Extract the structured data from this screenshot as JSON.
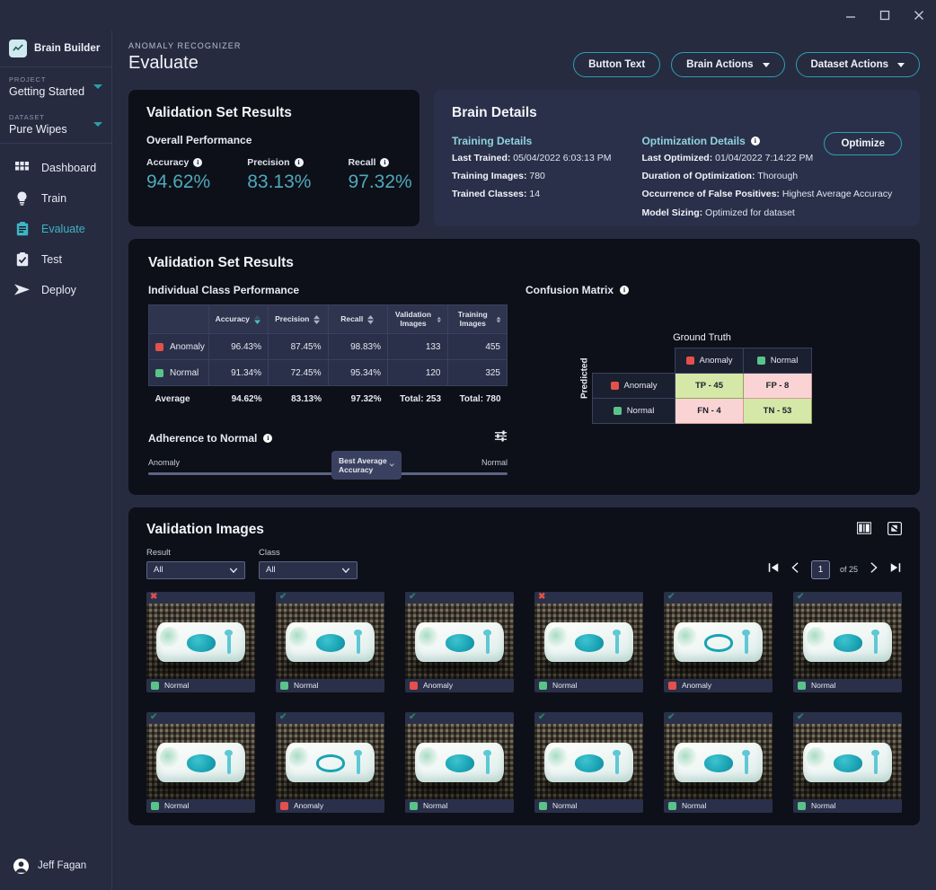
{
  "window": {
    "minimize": "minimize-icon",
    "maximize": "maximize-icon",
    "close": "close-icon"
  },
  "sidebar": {
    "brand": "Brain Builder",
    "project_label": "PROJECT",
    "project_value": "Getting Started",
    "dataset_label": "DATASET",
    "dataset_value": "Pure Wipes",
    "nav": [
      {
        "label": "Dashboard",
        "icon": "grid-icon",
        "active": false
      },
      {
        "label": "Train",
        "icon": "bulb-icon",
        "active": false
      },
      {
        "label": "Evaluate",
        "icon": "clipboard-icon",
        "active": true
      },
      {
        "label": "Test",
        "icon": "clipboard-check-icon",
        "active": false
      },
      {
        "label": "Deploy",
        "icon": "send-icon",
        "active": false
      }
    ],
    "user": "Jeff Fagan"
  },
  "header": {
    "eyebrow": "ANOMALY RECOGNIZER",
    "title": "Evaluate",
    "buttons": [
      {
        "label": "Button Text",
        "caret": false
      },
      {
        "label": "Brain Actions",
        "caret": true
      },
      {
        "label": "Dataset Actions",
        "caret": true
      }
    ]
  },
  "overall": {
    "title": "Validation Set Results",
    "subtitle": "Overall Performance",
    "metrics": [
      {
        "label": "Accuracy",
        "value": "94.62%"
      },
      {
        "label": "Precision",
        "value": "83.13%"
      },
      {
        "label": "Recall",
        "value": "97.32%"
      }
    ]
  },
  "brain_details": {
    "title": "Brain Details",
    "training_heading": "Training Details",
    "optimization_heading": "Optimization Details",
    "optimize_button": "Optimize",
    "training": [
      {
        "key": "Last Trained:",
        "value": "05/04/2022 6:03:13 PM"
      },
      {
        "key": "Training Images:",
        "value": "780"
      },
      {
        "key": "Trained Classes:",
        "value": "14"
      }
    ],
    "optimization": [
      {
        "key": "Last Optimized:",
        "value": "01/04/2022 7:14:22 PM"
      },
      {
        "key": "Duration of Optimization:",
        "value": "Thorough"
      },
      {
        "key": "Occurrence of False Positives:",
        "value": "Highest Average Accuracy"
      },
      {
        "key": "Model Sizing:",
        "value": "Optimized for dataset"
      }
    ]
  },
  "results": {
    "title": "Validation Set Results",
    "table_heading": "Individual Class Performance",
    "columns": [
      "",
      "Accuracy",
      "Precision",
      "Recall",
      "Validation Images",
      "Training Images"
    ],
    "sorted_column": "Accuracy",
    "rows": [
      {
        "class": "Anomaly",
        "color": "#e2514b",
        "accuracy": "96.43%",
        "precision": "87.45%",
        "recall": "98.83%",
        "validation_images": "133",
        "training_images": "455"
      },
      {
        "class": "Normal",
        "color": "#59c38a",
        "accuracy": "91.34%",
        "precision": "72.45%",
        "recall": "95.34%",
        "validation_images": "120",
        "training_images": "325"
      }
    ],
    "average": {
      "class": "Average",
      "accuracy": "94.62%",
      "precision": "83.13%",
      "recall": "97.32%",
      "validation_images": "Total: 253",
      "training_images": "Total: 780"
    },
    "adherence": {
      "title": "Adherence to Normal",
      "left_end": "Anomaly",
      "right_end": "Normal",
      "selected_option": "Best Average Accuracy"
    },
    "confusion": {
      "title": "Confusion Matrix",
      "ground_truth_label": "Ground Truth",
      "predicted_label": "Predicted",
      "col_headers": [
        "Anomaly",
        "Normal"
      ],
      "row_headers": [
        "Anomaly",
        "Normal"
      ],
      "cells": [
        [
          {
            "text": "TP - 45",
            "tone": "good"
          },
          {
            "text": "FP - 8",
            "tone": "bad"
          }
        ],
        [
          {
            "text": "FN - 4",
            "tone": "bad"
          },
          {
            "text": "TN - 53",
            "tone": "good"
          }
        ]
      ]
    }
  },
  "validation_images": {
    "title": "Validation Images",
    "icons": [
      "split-view-icon",
      "expand-icon"
    ],
    "filters": [
      {
        "label": "Result",
        "value": "All"
      },
      {
        "label": "Class",
        "value": "All"
      }
    ],
    "pagination": {
      "page": "1",
      "of": "of 25"
    },
    "items": [
      {
        "mark": "x",
        "label": "Normal",
        "color": "#59c38a",
        "lid": "solid"
      },
      {
        "mark": "check",
        "label": "Normal",
        "color": "#59c38a",
        "lid": "solid"
      },
      {
        "mark": "check",
        "label": "Anomaly",
        "color": "#e2514b",
        "lid": "solid"
      },
      {
        "mark": "x",
        "label": "Normal",
        "color": "#59c38a",
        "lid": "solid"
      },
      {
        "mark": "check",
        "label": "Anomaly",
        "color": "#e2514b",
        "lid": "ring"
      },
      {
        "mark": "check",
        "label": "Normal",
        "color": "#59c38a",
        "lid": "solid"
      },
      {
        "mark": "check",
        "label": "Normal",
        "color": "#59c38a",
        "lid": "solid"
      },
      {
        "mark": "check",
        "label": "Anomaly",
        "color": "#e2514b",
        "lid": "ring"
      },
      {
        "mark": "check",
        "label": "Normal",
        "color": "#59c38a",
        "lid": "solid"
      },
      {
        "mark": "check",
        "label": "Normal",
        "color": "#59c38a",
        "lid": "solid"
      },
      {
        "mark": "check",
        "label": "Normal",
        "color": "#59c38a",
        "lid": "solid"
      },
      {
        "mark": "check",
        "label": "Normal",
        "color": "#59c38a",
        "lid": "solid"
      }
    ]
  },
  "colors": {
    "accent": "#2e9fb0",
    "metric": "#4fa8bd",
    "page_bg": "#262b40",
    "card_dark": "#0d1018",
    "card_navy": "#2a3049",
    "anomaly": "#e2514b",
    "normal": "#59c38a",
    "cm_good": "#d6e8a8",
    "cm_bad": "#fad4d4"
  }
}
